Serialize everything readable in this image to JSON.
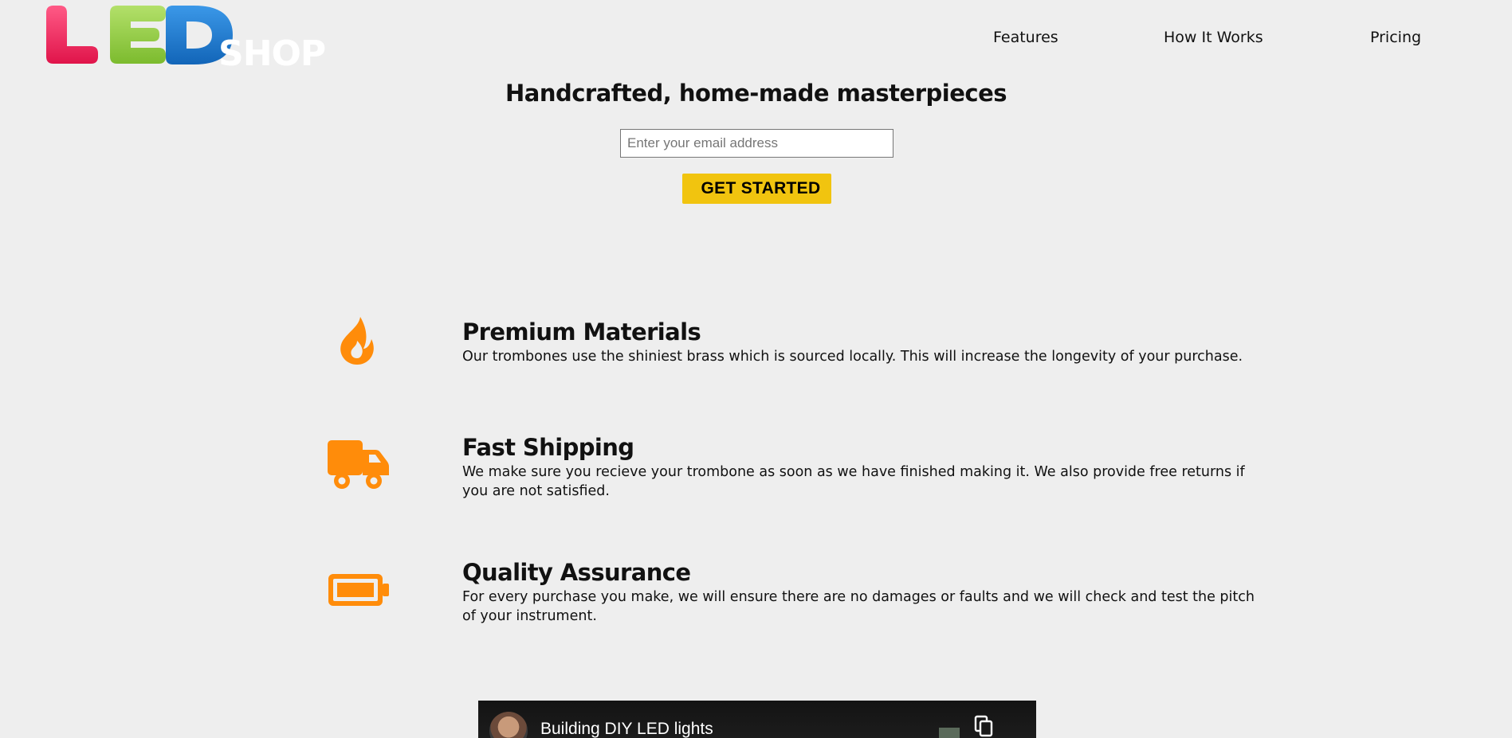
{
  "header": {
    "logo": {
      "letters": "LED",
      "word": "SHOP",
      "colors": {
        "L": "#e8174f",
        "E": "#8dc63f",
        "D": "#1a73c8",
        "shop": "#ffffff"
      }
    },
    "nav": [
      {
        "label": "Features"
      },
      {
        "label": "How It Works"
      },
      {
        "label": "Pricing"
      }
    ]
  },
  "hero": {
    "title": "Handcrafted, home-made masterpieces",
    "email_placeholder": "Enter your email address",
    "cta_label": "GET STARTED"
  },
  "features": [
    {
      "icon": "fire-icon",
      "title": "Premium Materials",
      "text": "Our trombones use the shiniest brass which is sourced locally. This will increase the longevity of your purchase."
    },
    {
      "icon": "truck-icon",
      "title": "Fast Shipping",
      "text": "We make sure you recieve your trombone as soon as we have finished making it. We also provide free returns if you are not satisfied."
    },
    {
      "icon": "battery-icon",
      "title": "Quality Assurance",
      "text": "For every purchase you make, we will ensure there are no damages or faults and we will check and test the pitch of your instrument."
    }
  ],
  "video": {
    "title": "Building DIY LED lights"
  },
  "colors": {
    "accent": "#f1c40f",
    "icon": "#ff8c0a",
    "background": "#eeeeee"
  }
}
